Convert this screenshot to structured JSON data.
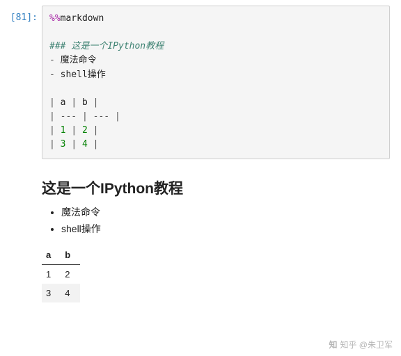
{
  "prompt": "[81]:",
  "code": {
    "magic": "%%markdown",
    "heading_md": "### 这是一个IPython教程",
    "bullet1": "魔法命令",
    "bullet2": "shell操作",
    "table_header_a": "a",
    "table_header_b": "b",
    "table_sep": "---",
    "row1_a": "1",
    "row1_b": "2",
    "row2_a": "3",
    "row2_b": "4",
    "pipe": "|",
    "dash": "-",
    "space": " "
  },
  "output": {
    "heading": "这是一个IPython教程",
    "items": [
      "魔法命令",
      "shell操作"
    ],
    "table": {
      "headers": [
        "a",
        "b"
      ],
      "rows": [
        [
          "1",
          "2"
        ],
        [
          "3",
          "4"
        ]
      ]
    }
  },
  "watermark": {
    "logo": "知",
    "text": "知乎 @朱卫军"
  }
}
